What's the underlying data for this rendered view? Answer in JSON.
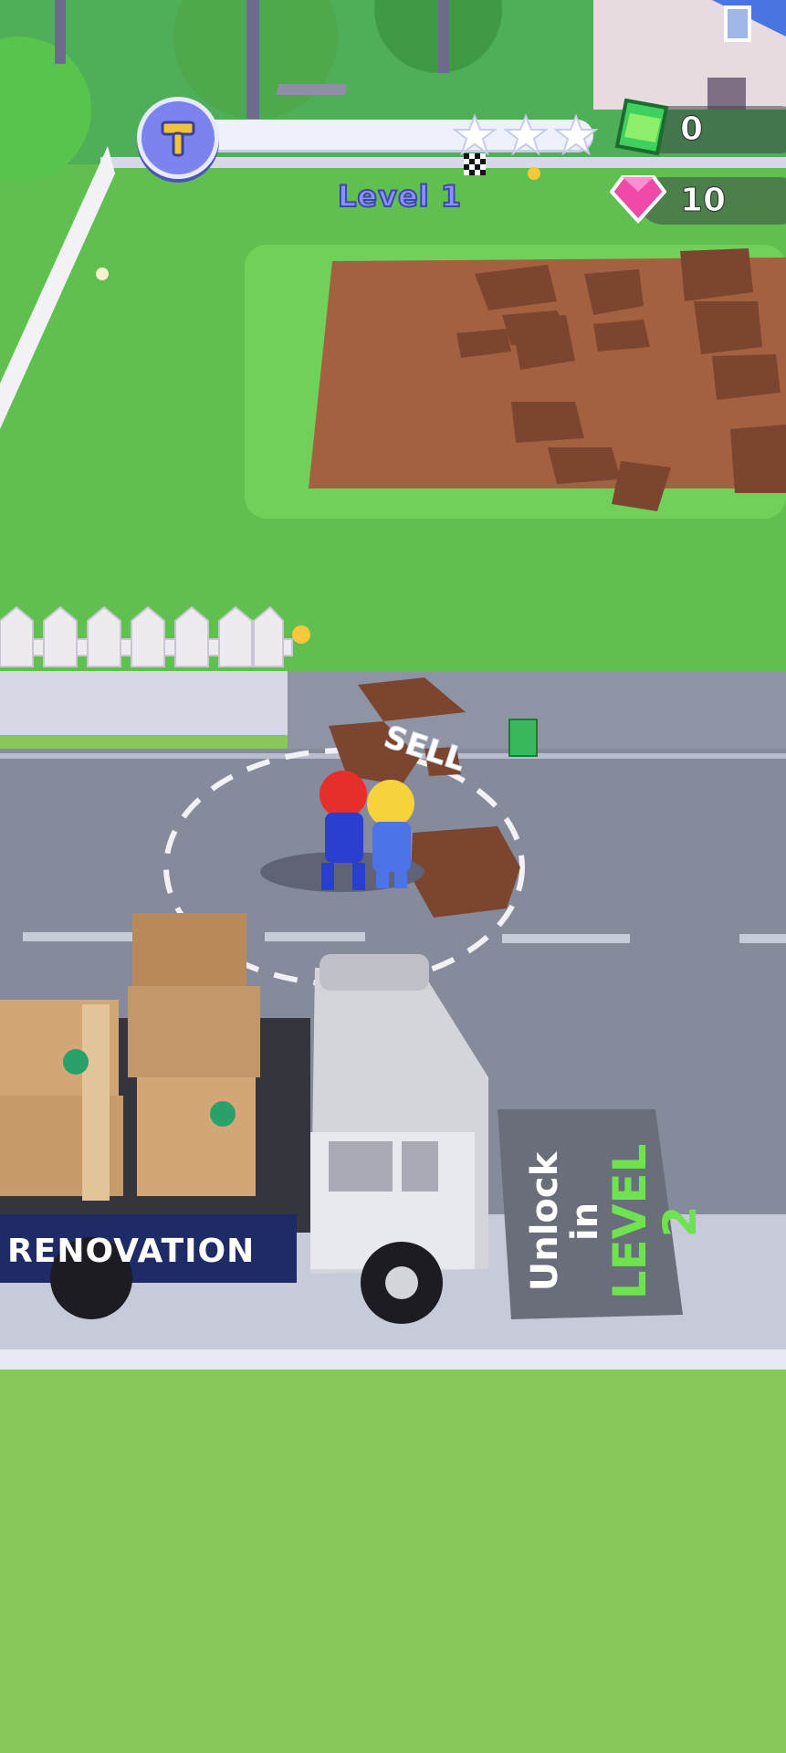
{
  "hud": {
    "level_label": "Level 1",
    "level_progress": 0,
    "stars_total": 3,
    "stars_earned": 0,
    "cash_count": "0",
    "gem_count": "10",
    "hammer_icon": "hammer-icon",
    "cash_icon": "cash-icon",
    "gem_icon": "gem-icon",
    "finish_flag_icon": "checkered-flag-icon"
  },
  "world": {
    "sell_label": "SELL",
    "truck_label": "RENOVATION",
    "unlock_line1": "Unlock in",
    "unlock_line2": "LEVEL 2"
  },
  "colors": {
    "grass": "#86c95a",
    "road": "#8a8f9f",
    "dirt": "#9a5a3c",
    "accent": "#7b84ee",
    "unlock_green": "#6ee24f"
  }
}
